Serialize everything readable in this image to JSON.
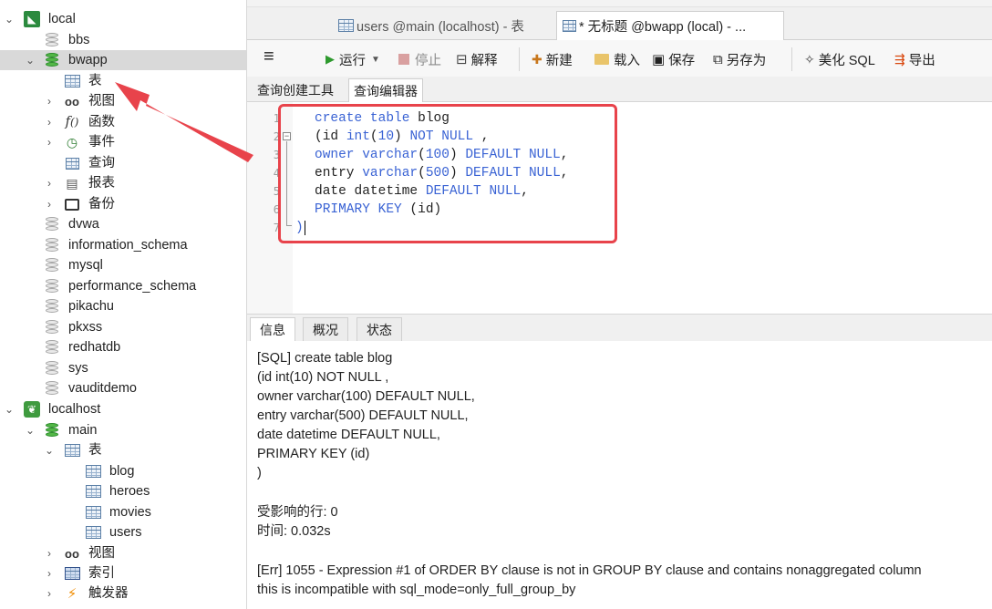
{
  "tree": {
    "connection_local": "local",
    "db_bbs": "bbs",
    "db_bwapp": "bwapp",
    "bwapp_children": {
      "tables": "表",
      "views": "视图",
      "functions": "函数",
      "events": "事件",
      "queries": "查询",
      "reports": "报表",
      "backups": "备份"
    },
    "other_dbs": [
      "dvwa",
      "information_schema",
      "mysql",
      "performance_schema",
      "pikachu",
      "pkxss",
      "redhatdb",
      "sys",
      "vauditdemo"
    ],
    "connection_localhost": "localhost",
    "db_main": "main",
    "main_children": {
      "tables": "表",
      "table_list": [
        "blog",
        "heroes",
        "movies",
        "users"
      ],
      "views": "视图",
      "indexes": "索引",
      "triggers": "触发器"
    }
  },
  "tabs": [
    {
      "label": "users @main (localhost) - 表"
    },
    {
      "label": "* 无标题 @bwapp (local) - ..."
    }
  ],
  "toolbar": {
    "menu": "≡",
    "run": "运行",
    "stop": "停止",
    "explain": "解释",
    "new": "新建",
    "load": "载入",
    "save": "保存",
    "save_as": "另存为",
    "beautify": "美化 SQL",
    "export": "导出"
  },
  "subtabs": [
    "查询创建工具",
    "查询编辑器"
  ],
  "editor": {
    "line_numbers": [
      "1",
      "2",
      "3",
      "4",
      "5",
      "6",
      "7"
    ]
  },
  "result_tabs": [
    "信息",
    "概况",
    "状态"
  ],
  "messages": {
    "sql_lines": [
      "[SQL]  create table blog",
      "  (id int(10) NOT NULL ,",
      "  owner varchar(100) DEFAULT NULL,",
      "  entry varchar(500) DEFAULT NULL,",
      "  date datetime DEFAULT NULL,",
      "  PRIMARY KEY (id)",
      ")"
    ],
    "affected_rows": "受影响的行: 0",
    "time": "时间: 0.032s",
    "error_line1": "[Err] 1055 - Expression #1 of ORDER BY clause is not in GROUP BY clause and contains nonaggregated column",
    "error_line2": "this is incompatible with sql_mode=only_full_group_by"
  },
  "colors": {
    "keyword": "#3a63d4",
    "annotation": "#e8434b",
    "selected_row": "#d9d9d9"
  }
}
